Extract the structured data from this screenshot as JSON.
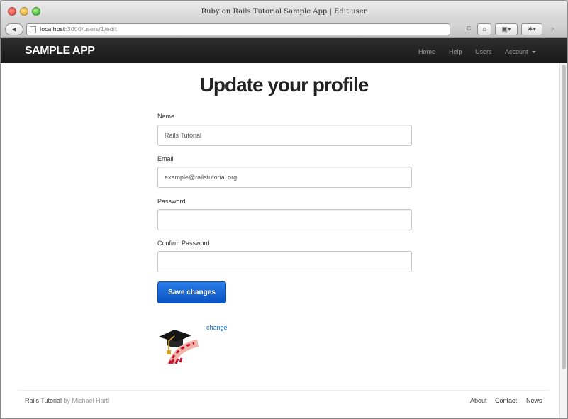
{
  "window": {
    "title": "Ruby on Rails Tutorial Sample App | Edit user"
  },
  "browser": {
    "url_host": "localhost",
    "url_path": ":3000/users/1/edit",
    "back_glyph": "◀",
    "home_glyph": "⌂",
    "reload_glyph": "C",
    "menu_glyph": "▾"
  },
  "navbar": {
    "brand": "SAMPLE APP",
    "links": {
      "home": "Home",
      "help": "Help",
      "users": "Users",
      "account": "Account"
    }
  },
  "page": {
    "heading": "Update your profile"
  },
  "form": {
    "name_label": "Name",
    "name_value": "Rails Tutorial",
    "email_label": "Email",
    "email_value": "example@railstutorial.org",
    "password_label": "Password",
    "password_value": "",
    "confirm_label": "Confirm Password",
    "confirm_value": "",
    "submit_label": "Save changes"
  },
  "gravatar": {
    "change_link": "change",
    "icon": "rails-graduation-cap-icon"
  },
  "footer": {
    "brand": "Rails Tutorial",
    "byline": "by Michael Hartl",
    "links": {
      "about": "About",
      "contact": "Contact",
      "news": "News"
    }
  },
  "colors": {
    "navbar": "#222222",
    "button": "#0d5fd4",
    "link": "#0d6bdb"
  }
}
